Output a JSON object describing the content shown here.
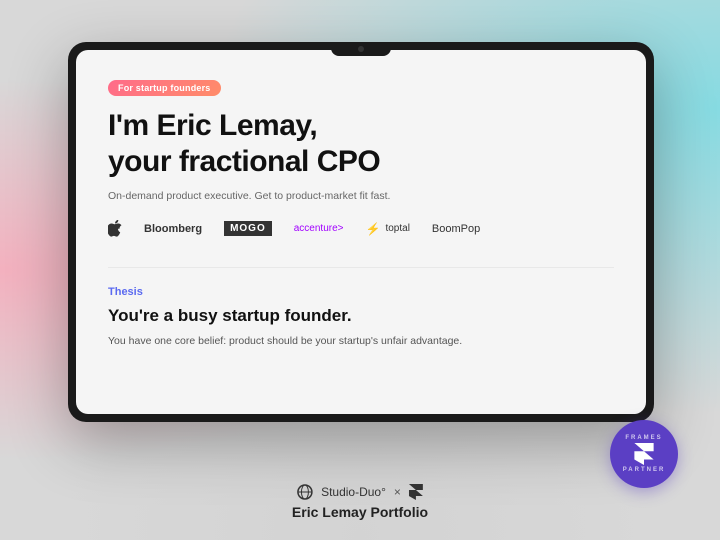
{
  "background": {
    "colors": {
      "pink": "#ffb0c8",
      "teal": "#64dce6",
      "base": "#d8d8d8"
    }
  },
  "device": {
    "camera_label": "camera"
  },
  "screen": {
    "tag": "For startup founders",
    "hero": {
      "heading_line1": "I'm Eric Lemay,",
      "heading_line2": "your fractional CPO",
      "subtext": "On-demand product executive. Get to product-market fit fast."
    },
    "logos": [
      {
        "id": "apple",
        "label": "Apple"
      },
      {
        "id": "bloomberg",
        "label": "Bloomberg"
      },
      {
        "id": "mogo",
        "label": "MOGO"
      },
      {
        "id": "accenture",
        "label": "accenture"
      },
      {
        "id": "toptal",
        "label": "↯ toptal"
      },
      {
        "id": "boompop",
        "label": "BoomPop"
      }
    ],
    "thesis": {
      "section_label": "Thesis",
      "heading": "You're a busy startup founder.",
      "body": "You have one core belief: product should be your startup's unfair advantage."
    }
  },
  "footer": {
    "studio_label": "Studio-Duo°",
    "times": "×",
    "framer_label": "≋",
    "title": "Eric Lemay Portfolio"
  },
  "badge": {
    "text_top": "FRAMES",
    "icon": "⟴",
    "text_bottom": "PARTNER"
  }
}
